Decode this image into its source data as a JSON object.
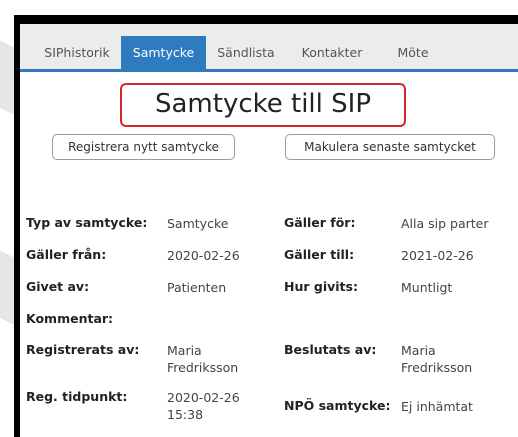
{
  "tabs": [
    {
      "label": "SIPhistorik",
      "active": false
    },
    {
      "label": "Samtycke",
      "active": true
    },
    {
      "label": "Sändlista",
      "active": false
    },
    {
      "label": "Kontakter",
      "active": false
    },
    {
      "label": "Möte",
      "active": false
    }
  ],
  "title": "Samtycke till SIP",
  "buttons": {
    "register": "Registrera nytt samtycke",
    "cancel_latest": "Makulera senaste samtycket"
  },
  "details": {
    "typ_label": "Typ av samtycke:",
    "typ_value": "Samtycke",
    "galler_for_label": "Gäller för:",
    "galler_for_value": "Alla sip parter",
    "galler_fran_label": "Gäller från:",
    "galler_fran_value": "2020-02-26",
    "galler_till_label": "Gäller till:",
    "galler_till_value": "2021-02-26",
    "givet_av_label": "Givet av:",
    "givet_av_value": "Patienten",
    "hur_givits_label": "Hur givits:",
    "hur_givits_value": "Muntligt",
    "kommentar_label": "Kommentar:",
    "registrerats_label": "Registrerats av:",
    "registrerats_value_line1": "Maria",
    "registrerats_value_line2": "Fredriksson",
    "beslutats_label": "Beslutats av:",
    "beslutats_value_line1": "Maria",
    "beslutats_value_line2": "Fredriksson",
    "reg_tidpunkt_label": "Reg. tidpunkt:",
    "reg_tidpunkt_line1": "2020-02-26",
    "reg_tidpunkt_line2": "15:38",
    "npo_label": "NPÖ samtycke:",
    "npo_value": "Ej inhämtat"
  },
  "colors": {
    "tab_active": "#2e7bbf",
    "highlight": "#d62828"
  }
}
